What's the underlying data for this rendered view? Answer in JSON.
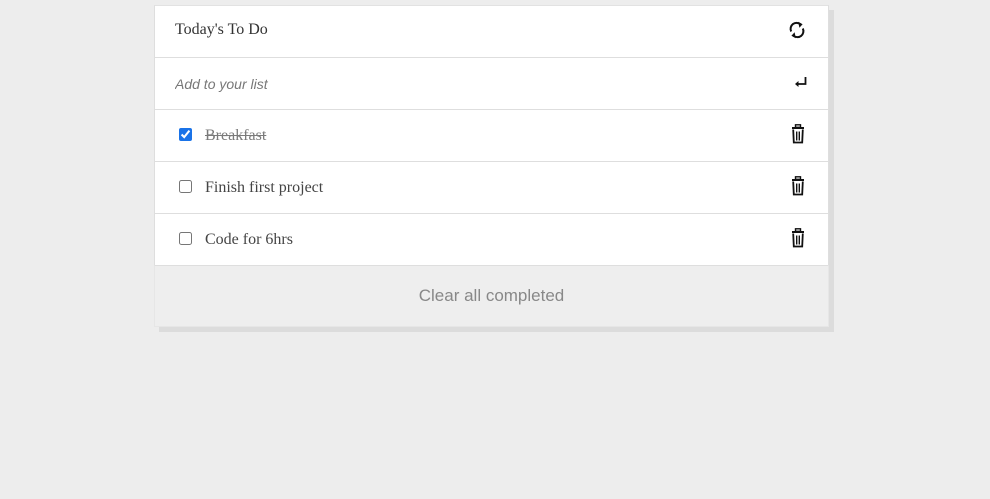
{
  "header": {
    "title": "Today's To Do",
    "refresh_icon": "refresh-icon"
  },
  "add": {
    "placeholder": "Add to your list",
    "enter_icon": "enter-icon"
  },
  "items": [
    {
      "label": "Breakfast",
      "completed": true
    },
    {
      "label": "Finish first project",
      "completed": false
    },
    {
      "label": "Code for 6hrs",
      "completed": false
    }
  ],
  "footer": {
    "clear_label": "Clear all completed"
  },
  "colors": {
    "background": "#ededed",
    "card": "#ffffff",
    "footer": "#eeeeee",
    "checkbox_accent": "#1a73e8"
  }
}
